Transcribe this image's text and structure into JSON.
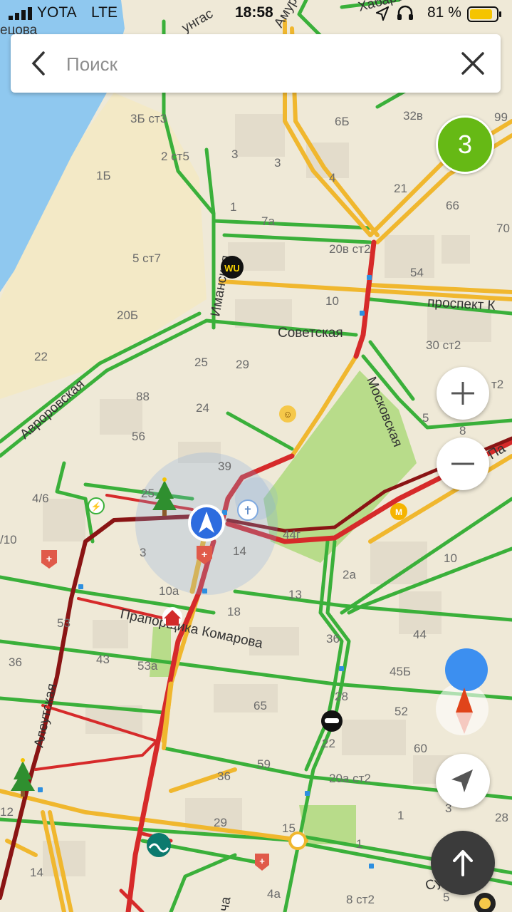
{
  "status_bar": {
    "carrier": "YOTA",
    "network": "LTE",
    "time": "18:58",
    "battery": "81 %"
  },
  "search": {
    "placeholder": "Поиск"
  },
  "traffic_level": "3",
  "map": {
    "streets": {
      "imanskaya": "Иманская",
      "sovetskaya": "Советская",
      "avrorovskaya": "Авроровская",
      "moskovskaya": "Московская",
      "praporshchika": "Прапорщика Комарова",
      "aleutskaya": "Алеутская",
      "prospekt": "проспект К",
      "amur": "Амур",
      "sungas": "унгас",
      "khabar": "Хабаро",
      "pa": "Па",
      "nechova": "ецова",
      "su": "Су",
      "cha": "ча"
    },
    "house_numbers": {
      "h1": "3Б ст3",
      "h2": "2 ст5",
      "h3": "1Б",
      "h4": "3",
      "h5": "3",
      "h6": "4",
      "h7": "6Б",
      "h8": "32в",
      "h9": "99",
      "h10": "21",
      "h11": "66",
      "h12": "70",
      "h13": "1",
      "h14": "7а",
      "h15": "20в ст2",
      "h16": "5 ст7",
      "h17": "54",
      "h18": "10",
      "h19": "20Б",
      "h20": "22",
      "h21": "25",
      "h22": "29",
      "h23": "30 ст2",
      "h24": "88",
      "h25": "24",
      "h26": "56",
      "h27": "т2",
      "h28": "5",
      "h29": "8",
      "h30": "39",
      "h31": "4/6",
      "h32": "25",
      "h33": "44г",
      "h34": "/10",
      "h35": "3",
      "h36": "14",
      "h37": "10",
      "h38": "2а",
      "h39": "10а",
      "h40": "13",
      "h41": "18",
      "h42": "53",
      "h43": "36",
      "h44": "44",
      "h45": "36",
      "h46": "43",
      "h47": "53а",
      "h48": "45Б",
      "h49": "28",
      "h50": "65",
      "h51": "52",
      "h52": "22",
      "h53": "60",
      "h54": "59",
      "h55": "36",
      "h56": "20а ст2",
      "h57": "12",
      "h58": "1",
      "h59": "3",
      "h60": "28",
      "h61": "29",
      "h62": "15",
      "h63": "1",
      "h64": "14",
      "h65": "4а",
      "h66": "8 ст2",
      "h67": "5"
    }
  },
  "controls": {
    "zoom_in": "+",
    "zoom_out": "−"
  },
  "colors": {
    "water": "#8fc8ef",
    "land": "#efe9d7",
    "park": "#b8dc8a",
    "road_green": "#3ab03a",
    "road_yellow": "#f0b72e",
    "road_red": "#d62a2a",
    "road_darkred": "#8a1414",
    "traffic_badge": "#66b915",
    "location_blue": "#2d6cdf"
  }
}
